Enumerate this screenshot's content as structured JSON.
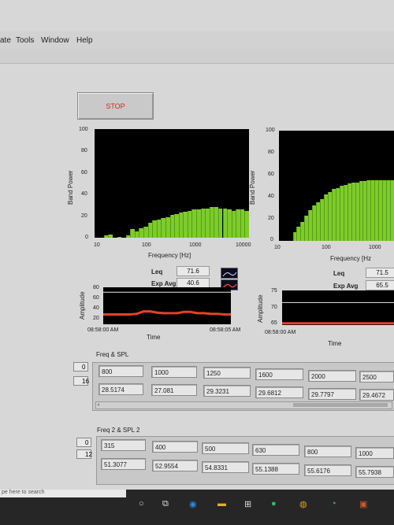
{
  "menu": {
    "items": [
      "ate",
      "Tools",
      "Window",
      "Help"
    ]
  },
  "stop_button": {
    "label": "STOP"
  },
  "spectrum_left": {
    "ylabel": "Band Power",
    "xlabel": "Frequency [Hz]",
    "yticks": [
      "100",
      "80",
      "60",
      "40",
      "20",
      "0"
    ],
    "xticks": [
      "10",
      "100",
      "1000",
      "10000"
    ]
  },
  "spectrum_right": {
    "ylabel": "Band Power",
    "xlabel": "Frequency [Hz",
    "yticks": [
      "100",
      "80",
      "60",
      "40",
      "20",
      "0"
    ],
    "xticks": [
      "10",
      "100",
      "1000"
    ]
  },
  "readouts_left": {
    "leq_label": "Leq",
    "leq_value": "71.6",
    "avg_label": "Exp Avg",
    "avg_value": "40.6"
  },
  "readouts_right": {
    "leq_label": "Leq",
    "leq_value": "71.5",
    "avg_label": "Exp Avg",
    "avg_value": "65.5"
  },
  "trend_left": {
    "ylabel": "Amplitude",
    "xlabel": "Time",
    "yticks": [
      "80",
      "60",
      "40",
      "20"
    ],
    "start_time": "08:58:00 AM",
    "end_time": "08:58:05 AM"
  },
  "trend_right": {
    "ylabel": "Amplitude",
    "xlabel": "Time",
    "yticks": [
      "75",
      "70",
      "65"
    ],
    "start_time": "08:58:00 AM"
  },
  "array1": {
    "title": "Freq & SPL",
    "index1": "0",
    "index2": "16",
    "freq": [
      "800",
      "1000",
      "1250",
      "1600",
      "2000",
      "2500"
    ],
    "spl": [
      "28.5174",
      "27.081",
      "29.3231",
      "29.6812",
      "29.7797",
      "29.4672"
    ]
  },
  "array2": {
    "title": "Freq 2 & SPL 2",
    "index1": "0",
    "index2": "12",
    "freq": [
      "315",
      "400",
      "500",
      "630",
      "800",
      "1000"
    ],
    "spl": [
      "51.3077",
      "52.9554",
      "54.8331",
      "55.1388",
      "55.6176",
      "55.7938"
    ]
  },
  "taskbar": {
    "search_placeholder": "pe here to search"
  },
  "colors": {
    "bar_green": "#7ccc2a",
    "trace_red": "#e5412a",
    "stop_red": "#e02020"
  },
  "chart_data": [
    {
      "type": "bar",
      "title": "",
      "xlabel": "Frequency [Hz]",
      "ylabel": "Band Power",
      "ylim": [
        0,
        100
      ],
      "x_scale": "log",
      "values": [
        2,
        3,
        0,
        1,
        0,
        2,
        8,
        6,
        9,
        10,
        14,
        16,
        17,
        18,
        19,
        21,
        22,
        23,
        24,
        25,
        26,
        26,
        27,
        27,
        28,
        28,
        27,
        27,
        26,
        25,
        26,
        26,
        25
      ]
    },
    {
      "type": "bar",
      "title": "",
      "xlabel": "Frequency [Hz",
      "ylabel": "Band Power",
      "ylim": [
        0,
        100
      ],
      "x_scale": "log",
      "values": [
        8,
        13,
        17,
        23,
        28,
        32,
        35,
        38,
        42,
        44,
        47,
        48,
        50,
        51,
        52,
        53,
        53,
        54,
        54,
        55,
        55,
        55,
        55,
        55,
        55,
        55
      ]
    },
    {
      "type": "line",
      "title": "",
      "xlabel": "Time",
      "ylabel": "Amplitude",
      "ylim": [
        20,
        80
      ],
      "series": [
        {
          "values": [
            36,
            36,
            36,
            36,
            36,
            37,
            41,
            41,
            39,
            38,
            38,
            38,
            40,
            40,
            38,
            38,
            37,
            37,
            36,
            36
          ]
        }
      ],
      "reference": 72
    },
    {
      "type": "line",
      "title": "",
      "xlabel": "Time",
      "ylabel": "Amplitude",
      "ylim": [
        65,
        75
      ],
      "series": [
        {
          "values": [
            65.5,
            65.5,
            65.5,
            65.5,
            65.5,
            65.5,
            65.5,
            65.5,
            65.5,
            65.5
          ]
        }
      ],
      "reference": 71.5
    }
  ]
}
